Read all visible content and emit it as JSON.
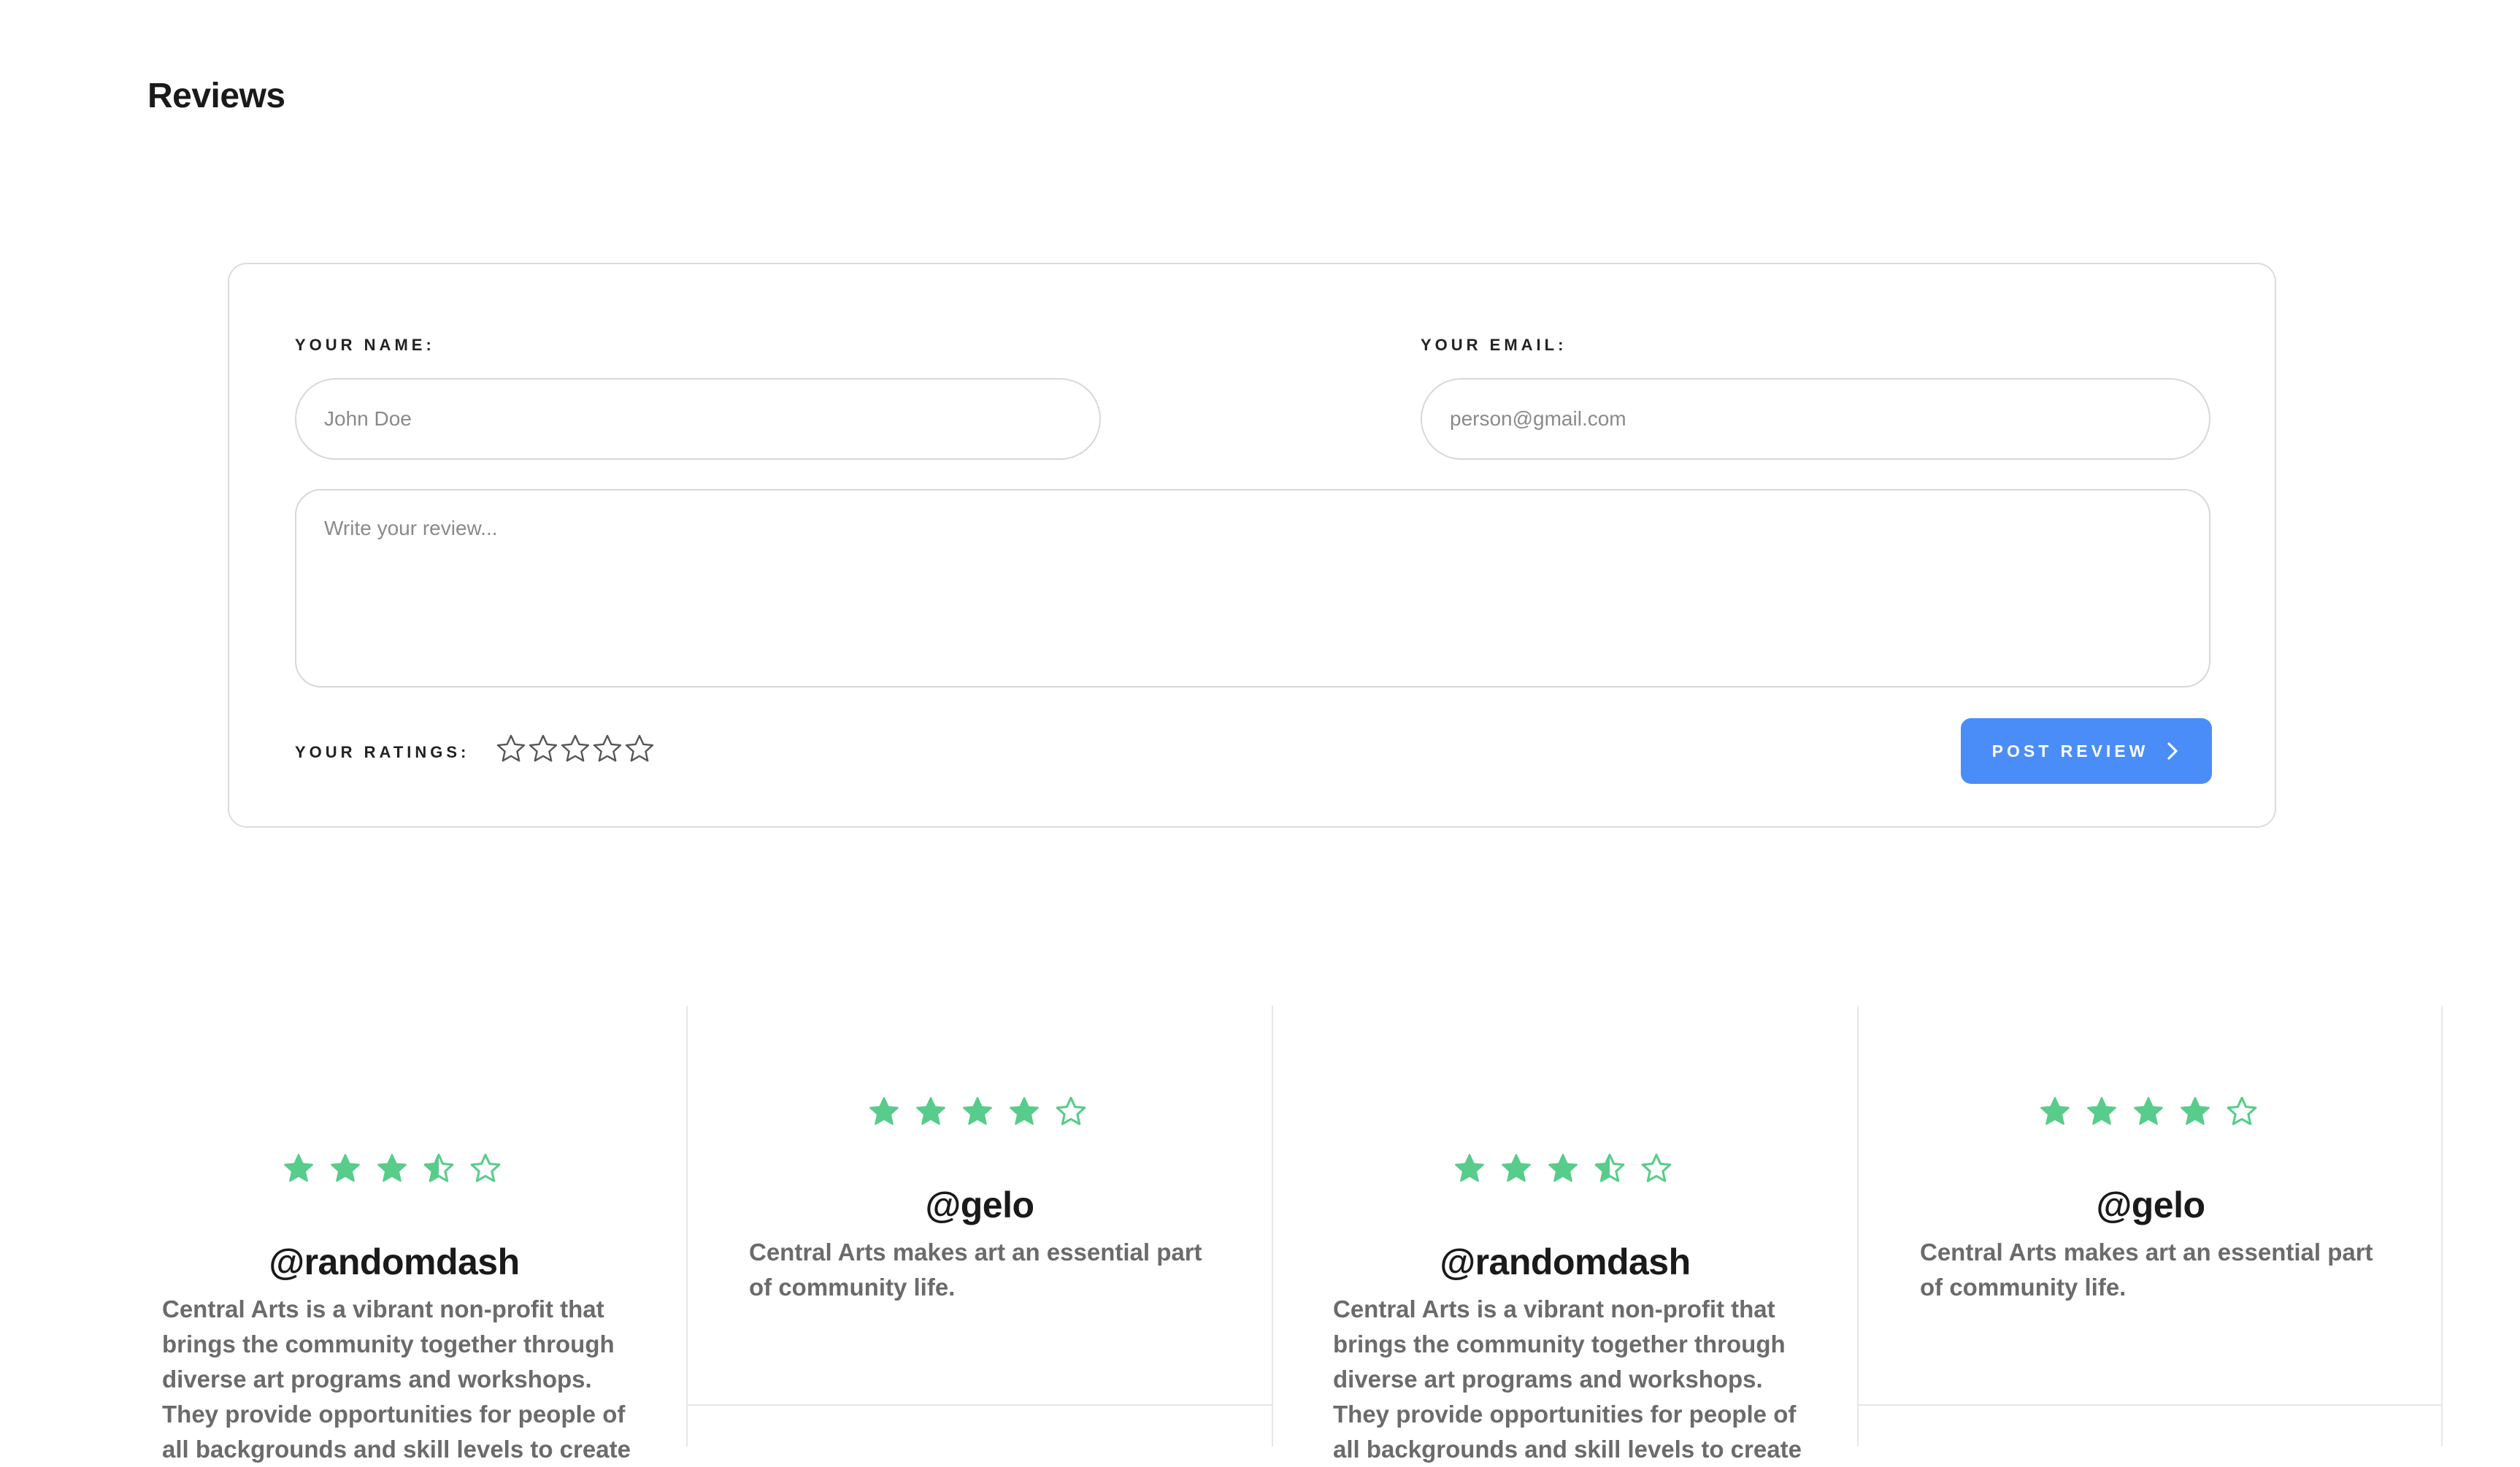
{
  "page": {
    "title": "Reviews"
  },
  "form": {
    "name_label": "YOUR NAME:",
    "name_placeholder": "John Doe",
    "email_label": "YOUR EMAIL:",
    "email_placeholder": "person@gmail.com",
    "review_placeholder": "Write your review...",
    "ratings_label": "YOUR RATINGS:",
    "rating_value": 0,
    "rating_max": 5,
    "submit_label": "POST REVIEW",
    "submit_icon": "chevron-right-icon"
  },
  "colors": {
    "accent": "#4b8df8",
    "star": "#58cc8a",
    "empty_star": "#555555"
  },
  "reviews": [
    {
      "username": "@randomdash",
      "rating": 3.5,
      "text": "Central Arts is a vibrant non-profit that brings the community together through diverse art programs and workshops. They provide opportunities for people of all backgrounds and skill levels to create"
    },
    {
      "username": "@gelo",
      "rating": 4,
      "text": "Central Arts makes art an essential part of community life."
    },
    {
      "username": "@randomdash",
      "rating": 3.5,
      "text": "Central Arts is a vibrant non-profit that brings the community together through diverse art programs and workshops. They provide opportunities for people of all backgrounds and skill levels to create"
    },
    {
      "username": "@gelo",
      "rating": 4,
      "text": "Central Arts makes art an essential part of community life."
    }
  ]
}
